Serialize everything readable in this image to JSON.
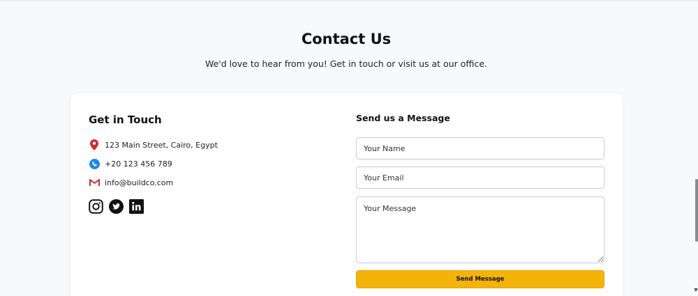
{
  "header": {
    "title": "Contact Us",
    "subtitle": "We'd love to hear from you! Get in touch or visit us at our office."
  },
  "contact": {
    "heading": "Get in Touch",
    "address": "123 Main Street, Cairo, Egypt",
    "phone": "+20 123 456 789",
    "email": "info@buildco.com",
    "icons": {
      "address": "map-pin-icon",
      "phone": "phone-icon",
      "email": "gmail-icon"
    },
    "socials": [
      "instagram-icon",
      "twitter-icon",
      "linkedin-icon"
    ]
  },
  "form": {
    "heading": "Send us a Message",
    "name_placeholder": "Your Name",
    "email_placeholder": "Your Email",
    "message_placeholder": "Your Message",
    "submit_label": "Send Message"
  },
  "colors": {
    "page_bg": "#f8f9fb",
    "card_bg": "#ffffff",
    "accent": "#f5b30a",
    "pin_red": "#d9262c",
    "phone_blue": "#1e88e5"
  }
}
